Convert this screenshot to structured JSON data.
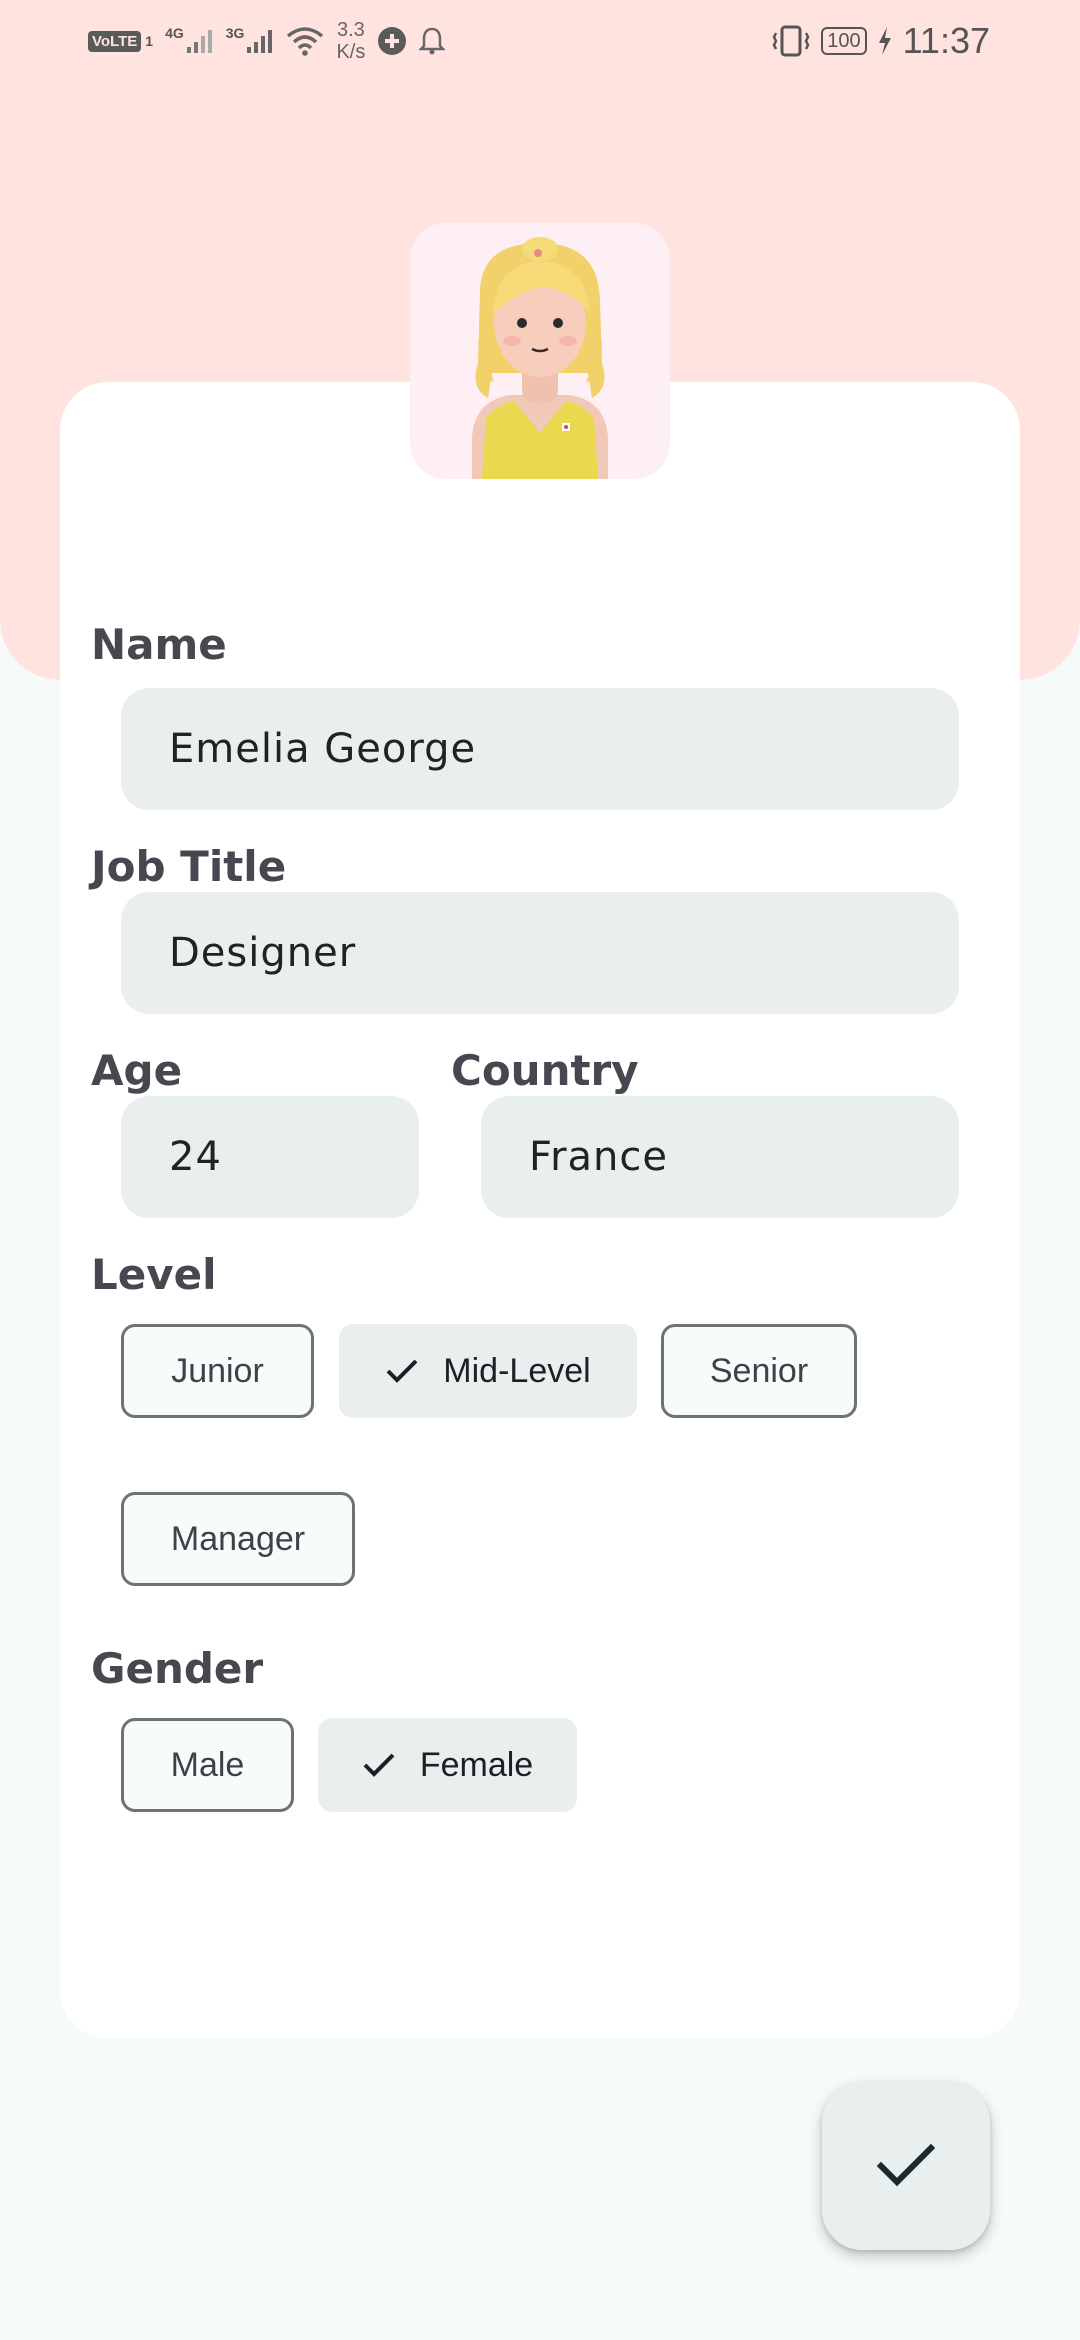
{
  "status_bar": {
    "volte": "VoLTE",
    "sim": "1",
    "net_4g": "4G",
    "net_3g": "3G",
    "speed_value": "3.3",
    "speed_unit": "K/s",
    "battery": "100",
    "time": "11:37"
  },
  "form": {
    "name_label": "Name",
    "name_value": "Emelia George",
    "job_title_label": "Job Title",
    "job_title_value": "Designer",
    "age_label": "Age",
    "age_value": "24",
    "country_label": "Country",
    "country_value": "France",
    "level_label": "Level",
    "level_options": [
      "Junior",
      "Mid-Level",
      "Senior",
      "Manager"
    ],
    "level_selected": "Mid-Level",
    "gender_label": "Gender",
    "gender_options": [
      "Male",
      "Female"
    ],
    "gender_selected": "Female"
  },
  "colors": {
    "header_bg": "#ffe3df",
    "page_bg": "#f7fafa",
    "card_bg": "#ffffff",
    "input_bg": "#e9efef",
    "avatar_bg": "#fdeff3"
  },
  "icons": {
    "fab": "check-icon",
    "selected_chip": "check-icon"
  }
}
